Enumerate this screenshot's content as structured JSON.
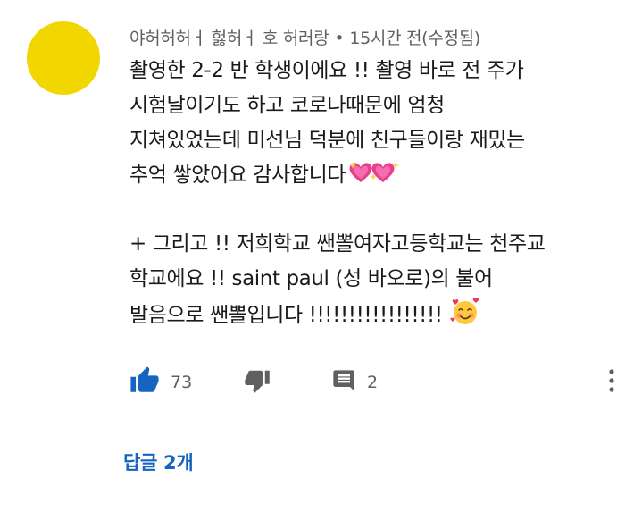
{
  "comment": {
    "author": "야허허허ㅓ 헗허ㅓ 호 허러랑",
    "separator": "•",
    "timestamp": "15시간 전(수정됨)",
    "body_lines": [
      "촬영한 2-2 반 학생이에요 !! 촬영 바로 전 주가",
      "시험날이기도 하고 코로나때문에 엄청",
      "지쳐있었는데 미선님 덕분에 친구들이랑 재밌는",
      "추억 쌓았어요 감사합니다",
      "+ 그리고 !! 저희학교 쌘뽈여자고등학교는 천주교",
      "학교에요 !! saint paul (성 바오로)의 불어",
      "발음으로 쌘뽈입니다 !!!!!!!!!!!!!!!!!"
    ],
    "emojis": {
      "hearts": "sparkling-heart-emoji",
      "face": "smiling-face-with-hearts-emoji"
    },
    "avatar_color": "#f2d600"
  },
  "actions": {
    "like_count": "73",
    "reply_count": "2",
    "accent_color": "#1565c0",
    "icons": {
      "like": "thumbs-up-icon",
      "dislike": "thumbs-down-icon",
      "reply": "comment-icon",
      "more": "more-vert-icon"
    }
  },
  "replies": {
    "label": "답글 2개"
  }
}
